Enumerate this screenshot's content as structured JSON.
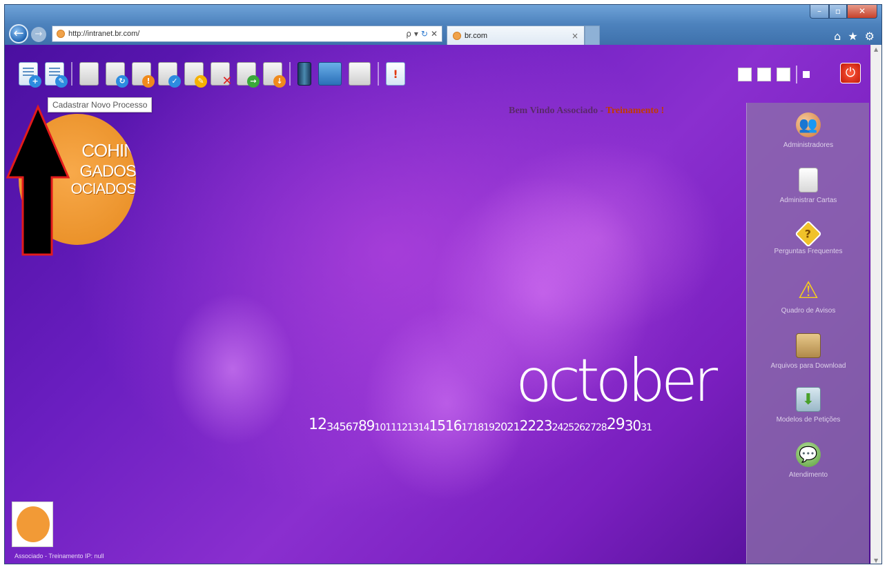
{
  "browser": {
    "url": "http://intranet.br.com/",
    "tab_title": "br.com",
    "back_glyph": "←",
    "forward_glyph": "→",
    "search_glyph": "ρ",
    "dropdown_glyph": "▾",
    "refresh_glyph": "↻",
    "stop_glyph": "✕",
    "tab_close_glyph": "×",
    "min_glyph": "–",
    "max_glyph": "▫",
    "close_glyph": "✕",
    "home_glyph": "⌂",
    "favorites_glyph": "★",
    "tools_glyph": "⚙"
  },
  "toolbar": {
    "tooltip": "Cadastrar Novo Processo",
    "power_glyph": "⏻",
    "icons": [
      "new-document-icon",
      "edit-document-icon",
      "envelope-icon",
      "envelope-refresh-icon",
      "envelope-warning-icon",
      "envelope-check-icon",
      "envelope-edit-icon",
      "envelope-delete-icon",
      "envelope-forward-icon",
      "envelope-download-icon",
      "database-icon",
      "monitor-icon",
      "copy-pages-icon",
      "alert-document-icon"
    ]
  },
  "header": {
    "welcome_prefix": "Bem Vindo Associado - ",
    "welcome_name": "Treinamento !"
  },
  "logo": {
    "line1": "COHIN",
    "line2": "GADOS",
    "line3": "OCIADOS"
  },
  "sidepanel": {
    "items": [
      {
        "label": "Administradores",
        "glyph": "👥",
        "icon": "people-icon"
      },
      {
        "label": "Administrar Cartas",
        "glyph": "",
        "icon": "letter-document-icon"
      },
      {
        "label": "Perguntas Frequentes",
        "glyph": "?",
        "icon": "faq-icon"
      },
      {
        "label": "Quadro de Avisos",
        "glyph": "⚠",
        "icon": "warning-icon"
      },
      {
        "label": "Arquivos para Download",
        "glyph": "",
        "icon": "box-icon"
      },
      {
        "label": "Modelos de Petições",
        "glyph": "⬇",
        "icon": "folder-download-icon"
      },
      {
        "label": "Atendimento",
        "glyph": "💬",
        "icon": "user-chat-icon"
      }
    ]
  },
  "calendar": {
    "month": "october",
    "days": [
      "1",
      "2",
      "3",
      "4",
      "5",
      "6",
      "7",
      "8",
      "9",
      "10",
      "11",
      "12",
      "13",
      "14",
      "15",
      "16",
      "17",
      "18",
      "19",
      "20",
      "21",
      "22",
      "23",
      "24",
      "25",
      "26",
      "27",
      "28",
      "29",
      "30",
      "31"
    ]
  },
  "footer": {
    "status": "Associado - Treinamento  IP: null"
  }
}
